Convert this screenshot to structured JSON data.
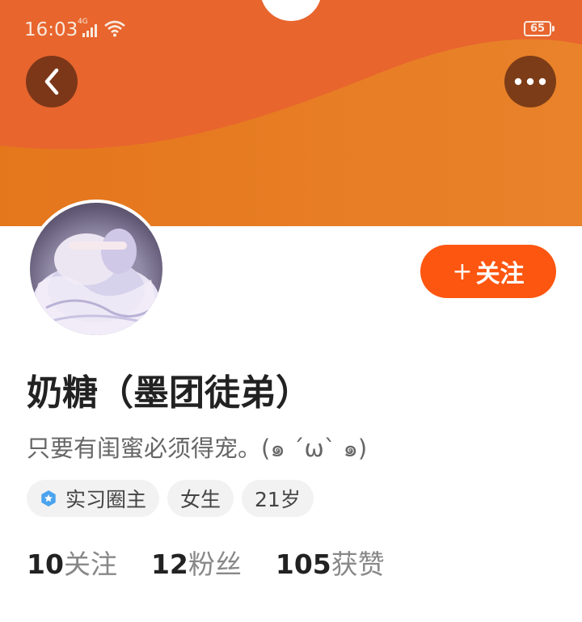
{
  "status_bar": {
    "time": "16:03",
    "network_type": "4G",
    "battery": "65"
  },
  "header": {
    "back_icon": "back-chevron-icon",
    "more_icon": "more-dots-icon",
    "banner_color": "#e9712a"
  },
  "profile": {
    "nickname": "奶糖（墨团徒弟）",
    "bio": "只要有闺蜜必须得宠。(๑ ´ω` ๑)",
    "follow_label": "关注",
    "follow_button_color": "#fd5610",
    "tags": [
      {
        "label": "实习圈主",
        "icon": "badge-star-icon"
      },
      {
        "label": "女生"
      },
      {
        "label": "21岁"
      }
    ],
    "stats": [
      {
        "value": "10",
        "label": "关注"
      },
      {
        "value": "12",
        "label": "粉丝"
      },
      {
        "value": "105",
        "label": "获赞"
      }
    ]
  }
}
